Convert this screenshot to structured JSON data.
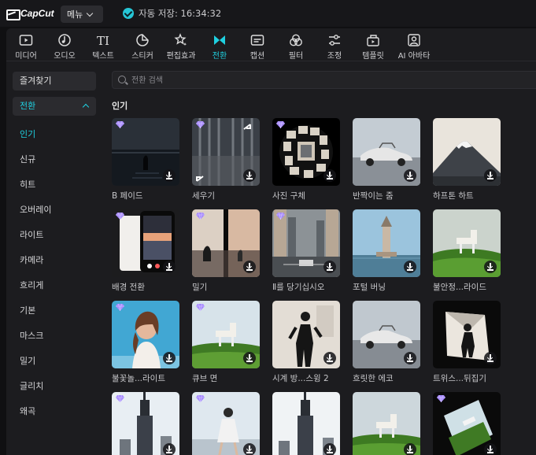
{
  "app": {
    "name": "CapCut"
  },
  "topbar": {
    "menu_label": "메뉴",
    "autosave_text": "자동 저장: 16:34:32"
  },
  "toolbar": {
    "items": [
      {
        "label": "미디어",
        "icon": "media-icon"
      },
      {
        "label": "오디오",
        "icon": "audio-icon"
      },
      {
        "label": "텍스트",
        "icon": "text-icon"
      },
      {
        "label": "스티커",
        "icon": "sticker-icon"
      },
      {
        "label": "편집효과",
        "icon": "effects-icon"
      },
      {
        "label": "전환",
        "icon": "transition-icon",
        "active": true
      },
      {
        "label": "캡션",
        "icon": "caption-icon"
      },
      {
        "label": "필터",
        "icon": "filter-icon"
      },
      {
        "label": "조정",
        "icon": "adjust-icon"
      },
      {
        "label": "템플릿",
        "icon": "template-icon"
      },
      {
        "label": "AI 아바타",
        "icon": "ai-avatar-icon"
      }
    ]
  },
  "sidebar": {
    "favorites": "즐겨찾기",
    "category": "전환",
    "items": [
      "인기",
      "신규",
      "히트",
      "오버레이",
      "라이트",
      "카메라",
      "흐리게",
      "기본",
      "마스크",
      "밀기",
      "글리치",
      "왜곡"
    ],
    "active_index": 0
  },
  "search": {
    "placeholder": "전환 검색"
  },
  "section": {
    "title": "인기"
  },
  "accent_color": "#1fd0e0",
  "thumbnails": [
    {
      "label": "B 페이드",
      "premium": true
    },
    {
      "label": "세우기",
      "premium": true
    },
    {
      "label": "사진 구체",
      "premium": true
    },
    {
      "label": "반짝이는 줌",
      "premium": false
    },
    {
      "label": "하프톤 하트",
      "premium": false
    },
    {
      "label": "배경 전환",
      "premium": true
    },
    {
      "label": "밀기",
      "premium": true
    },
    {
      "label": "Ⅱ를 당기십시오",
      "premium": true
    },
    {
      "label": "포털 버닝",
      "premium": false
    },
    {
      "label": "불안정...라이드",
      "premium": false
    },
    {
      "label": "불꽃놀...라이트",
      "premium": true
    },
    {
      "label": "큐브 면",
      "premium": true
    },
    {
      "label": "시계 방...스윙 2",
      "premium": false
    },
    {
      "label": "흐릿한 에코",
      "premium": false
    },
    {
      "label": "트위스...뒤집기",
      "premium": false
    },
    {
      "label": "",
      "premium": true
    },
    {
      "label": "",
      "premium": true
    },
    {
      "label": "",
      "premium": false
    },
    {
      "label": "",
      "premium": false
    },
    {
      "label": "",
      "premium": true
    }
  ]
}
